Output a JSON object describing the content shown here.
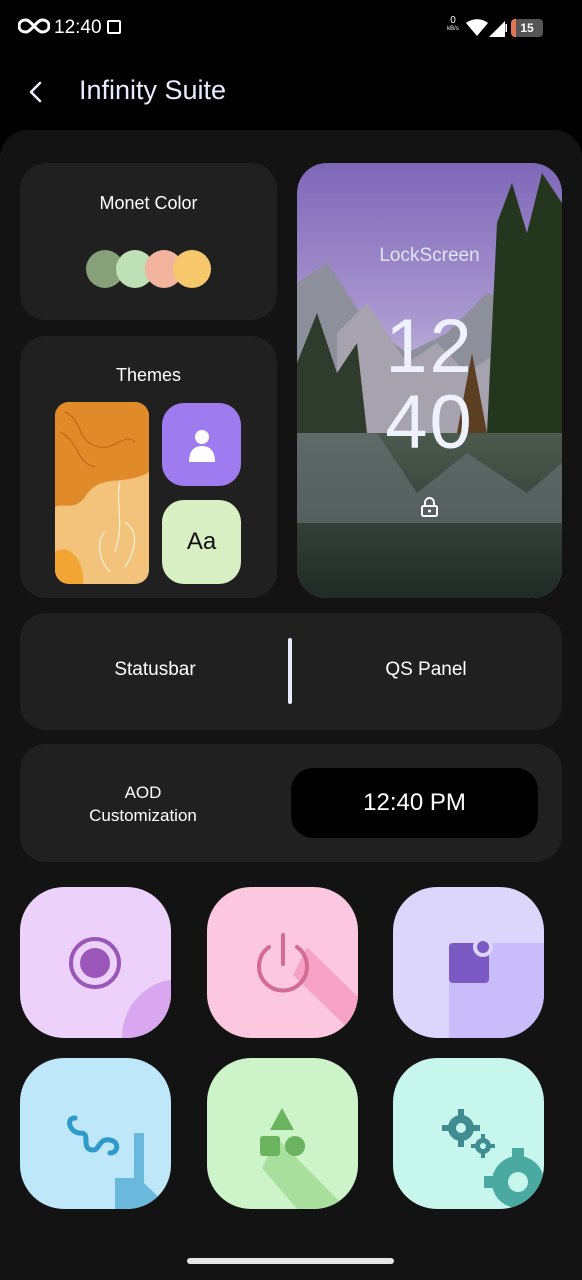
{
  "status_bar": {
    "time": "12:40",
    "net_speed_value": "0",
    "net_speed_unit": "kB/s",
    "battery_level": "15"
  },
  "header": {
    "title": "Infinity Suite"
  },
  "monet": {
    "label": "Monet Color",
    "swatches": [
      "#86a07a",
      "#bfe0b6",
      "#f2b49f",
      "#f6c86b"
    ]
  },
  "themes": {
    "label": "Themes",
    "font_sample": "Aa"
  },
  "lockscreen": {
    "label": "LockScreen",
    "hour": "12",
    "minute": "40"
  },
  "statusbar_qs": {
    "left_label": "Statusbar",
    "right_label": "QS Panel"
  },
  "aod": {
    "label": "AOD\nCustomization",
    "clock": "12:40 PM"
  },
  "tiles": [
    {
      "icon": "record-icon",
      "color": "#ecd2fb"
    },
    {
      "icon": "power-icon",
      "color": "#fbc8df"
    },
    {
      "icon": "notification-icon",
      "color": "#dcd6fd"
    },
    {
      "icon": "gesture-icon",
      "color": "#bfe7fa"
    },
    {
      "icon": "shapes-icon",
      "color": "#cdf4c8"
    },
    {
      "icon": "settings-icon",
      "color": "#c7f6ec"
    }
  ]
}
